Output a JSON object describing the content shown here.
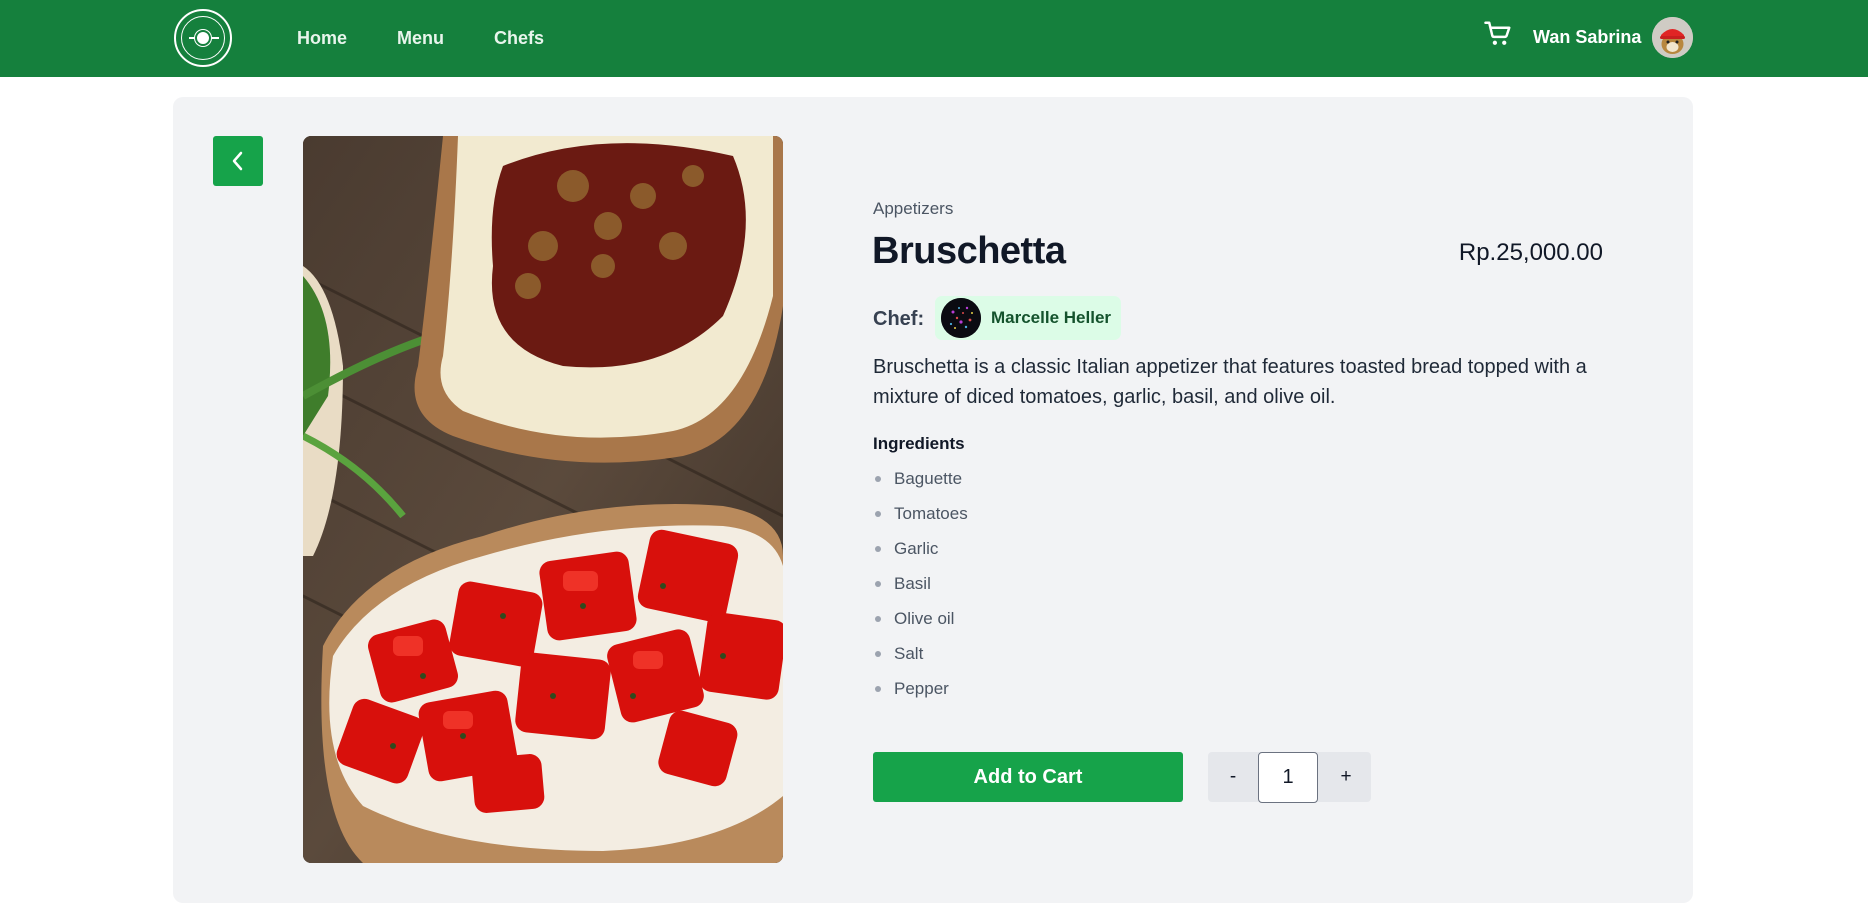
{
  "nav": {
    "links": [
      "Home",
      "Menu",
      "Chefs"
    ],
    "user_name": "Wan Sabrina",
    "icons": {
      "logo": "restaurant-logo",
      "cart": "cart-icon",
      "avatar": "user-avatar"
    }
  },
  "product": {
    "category": "Appetizers",
    "name": "Bruschetta",
    "price": "Rp.25,000.00",
    "chef_label": "Chef:",
    "chef_name": "Marcelle Heller",
    "description": "Bruschetta is a classic Italian appetizer that features toasted bread topped with a mixture of diced tomatoes, garlic, basil, and olive oil.",
    "ingredients_title": "Ingredients",
    "ingredients": [
      "Baguette",
      "Tomatoes",
      "Garlic",
      "Basil",
      "Olive oil",
      "Salt",
      "Pepper"
    ]
  },
  "actions": {
    "add_to_cart": "Add to Cart",
    "minus": "-",
    "plus": "+",
    "quantity": "1"
  },
  "colors": {
    "navbar": "#15803d",
    "primary_button": "#16a34a",
    "card_bg": "#f2f3f5",
    "chef_chip": "#dcfce7"
  }
}
